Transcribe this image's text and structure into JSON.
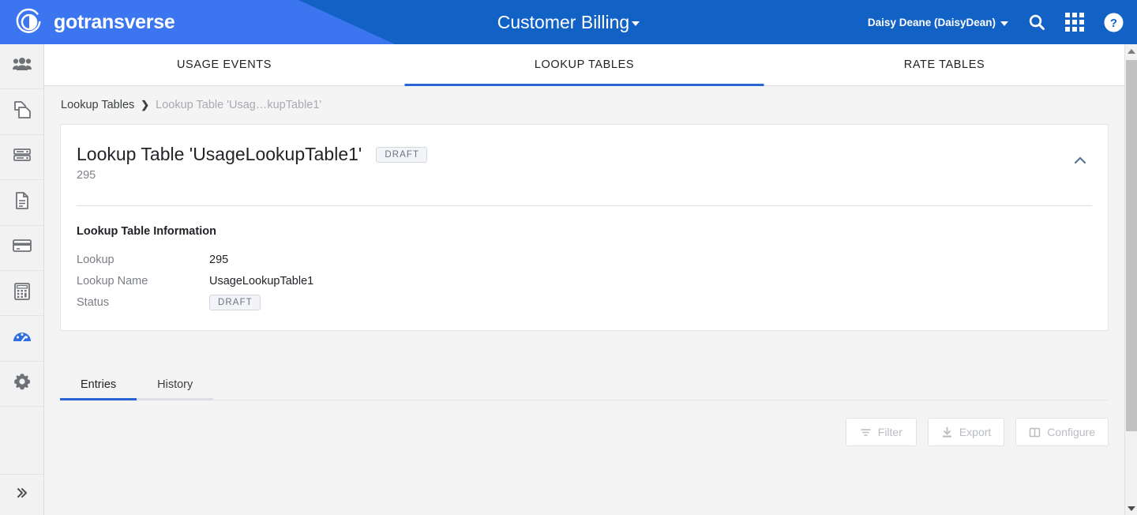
{
  "header": {
    "brand": "gotransverse",
    "brand_logo_icon": "circular-arrow-logo-icon",
    "title": "Customer Billing",
    "title_caret_icon": "caret-down-icon",
    "user": "Daisy Deane (DaisyDean)",
    "user_caret_icon": "caret-down-icon",
    "search_icon": "search-icon",
    "apps_icon": "apps-grid-icon",
    "help_icon": "help-circle-icon",
    "colors": {
      "primary_dark": "#1261c4",
      "primary_light": "#3b75f0",
      "accent": "#2a65d8"
    }
  },
  "sidebar": {
    "items": [
      {
        "name": "customers",
        "icon": "people-group-icon",
        "active": false
      },
      {
        "name": "products",
        "icon": "copy-documents-icon",
        "active": false
      },
      {
        "name": "servers",
        "icon": "server-stack-icon",
        "active": false
      },
      {
        "name": "documents",
        "icon": "document-icon",
        "active": false
      },
      {
        "name": "payments",
        "icon": "credit-card-icon",
        "active": false
      },
      {
        "name": "calculations",
        "icon": "calculator-icon",
        "active": false
      },
      {
        "name": "usage",
        "icon": "speedometer-icon",
        "active": true
      },
      {
        "name": "settings",
        "icon": "gear-icon",
        "active": false
      }
    ],
    "expand_icon": "double-chevron-right-icon"
  },
  "tabs_top": [
    {
      "label": "USAGE EVENTS",
      "active": false
    },
    {
      "label": "LOOKUP TABLES",
      "active": true
    },
    {
      "label": "RATE TABLES",
      "active": false
    }
  ],
  "breadcrumb": {
    "root": "Lookup Tables",
    "separator": "❯",
    "current": "Lookup Table 'Usag…kupTable1'"
  },
  "card": {
    "title": "Lookup Table 'UsageLookupTable1'",
    "status_badge": "DRAFT",
    "subtitle": "295",
    "collapse_icon": "chevron-up-icon",
    "section_title": "Lookup Table Information",
    "fields": [
      {
        "label": "Lookup",
        "value": "295",
        "type": "text"
      },
      {
        "label": "Lookup Name",
        "value": "UsageLookupTable1",
        "type": "text"
      },
      {
        "label": "Status",
        "value": "DRAFT",
        "type": "badge"
      }
    ]
  },
  "tabs_sub": [
    {
      "label": "Entries",
      "active": true
    },
    {
      "label": "History",
      "active": false
    }
  ],
  "actions": [
    {
      "label": "Filter",
      "icon": "filter-icon",
      "disabled": true
    },
    {
      "label": "Export",
      "icon": "download-icon",
      "disabled": true
    },
    {
      "label": "Configure",
      "icon": "columns-icon",
      "disabled": true
    }
  ],
  "scrollbar": {
    "up_icon": "triangle-up-icon",
    "down_icon": "triangle-down-icon"
  }
}
